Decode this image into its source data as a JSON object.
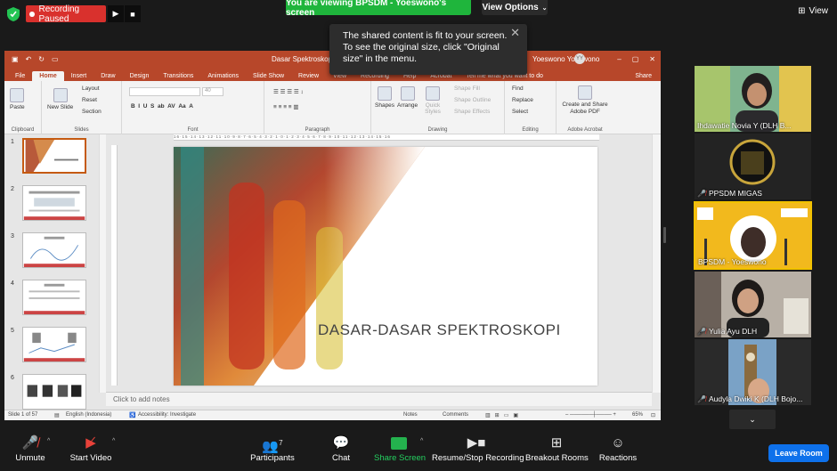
{
  "top_bar": {
    "recording_status": "Recording Paused",
    "viewing_banner": "You are viewing BPSDM - Yoeswono's screen",
    "view_options": "View Options",
    "view_toggle": "View"
  },
  "tooltip": {
    "text": "The shared content is fit to your screen. To see the original size, click \"Original size\" in the menu."
  },
  "ppt": {
    "doc_title": "Dasar Spektroskop",
    "user_name": "Yoeswono Yoeswono",
    "user_initials": "YY",
    "tabs": [
      "File",
      "Home",
      "Insert",
      "Draw",
      "Design",
      "Transitions",
      "Animations",
      "Slide Show",
      "Review",
      "View",
      "Recording",
      "Help",
      "Acrobat"
    ],
    "tell_me": "Tell me what you want to do",
    "share_label": "Share",
    "ribbon": {
      "paste": "Paste",
      "new_slide": "New Slide",
      "layout": "Layout",
      "reset": "Reset",
      "section": "Section",
      "font_size": "40",
      "shapes": "Shapes",
      "arrange": "Arrange",
      "quick_styles": "Quick Styles",
      "shape_fill": "Shape Fill",
      "shape_outline": "Shape Outline",
      "shape_effects": "Shape Effects",
      "find": "Find",
      "replace": "Replace",
      "select": "Select",
      "create_share": "Create and Share Adobe PDF",
      "groups": [
        "Clipboard",
        "Slides",
        "Font",
        "Paragraph",
        "Drawing",
        "Editing",
        "Adobe Acrobat"
      ]
    },
    "slide_numbers": [
      "1",
      "2",
      "3",
      "4",
      "5",
      "6"
    ],
    "slide_title": "DASAR-DASAR SPEKTROSKOPI",
    "notes_placeholder": "Click to add notes",
    "status": {
      "slide_count": "Slide 1 of 57",
      "language": "English (Indonesia)",
      "accessibility": "Accessibility: Investigate",
      "notes": "Notes",
      "comments": "Comments",
      "zoom": "65%"
    }
  },
  "participants": [
    {
      "name": "Ihdawatie Novia Y (DLH B...",
      "muted": false
    },
    {
      "name": "PPSDM MIGAS",
      "muted": true
    },
    {
      "name": "BPSDM - Yoeswono",
      "muted": false
    },
    {
      "name": "Yulia Ayu  DLH",
      "muted": true
    },
    {
      "name": "Audyla Dwiki K (DLH Bojo...",
      "muted": true
    }
  ],
  "toolbar": {
    "unmute": "Unmute",
    "start_video": "Start Video",
    "participants": "Participants",
    "participant_count": "7",
    "chat": "Chat",
    "share_screen": "Share Screen",
    "resume_recording": "Resume/Stop Recording",
    "breakout_rooms": "Breakout Rooms",
    "reactions": "Reactions",
    "leave": "Leave Room"
  },
  "colors": {
    "recording": "#d9312d",
    "banner_green": "#1fb53c",
    "ppt_orange": "#b7472a",
    "active_speaker": "#f2c200",
    "leave_blue": "#0e71eb"
  }
}
